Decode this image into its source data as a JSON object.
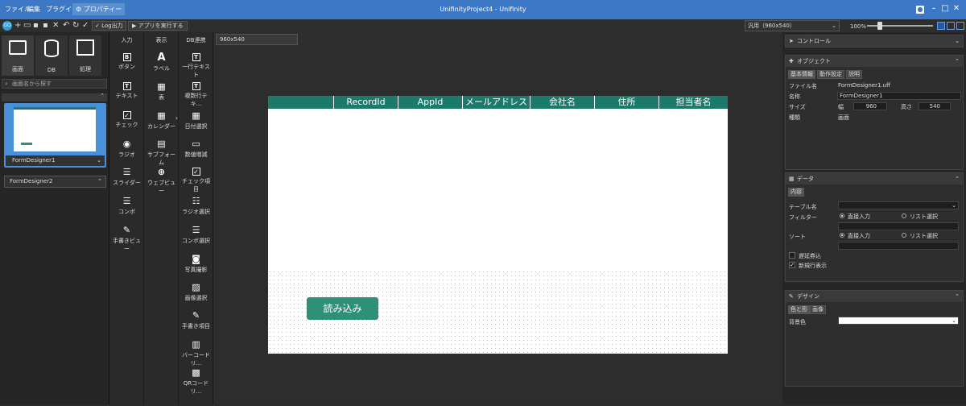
{
  "titlebar": {
    "menus": [
      "ファイル",
      "編集",
      "プラグイン",
      "⚙ プロパティー"
    ],
    "title": "UnifinityProject4 - Unifinity"
  },
  "toolbar": {
    "log_label": "Log出力",
    "run_label": "▶ アプリを実行する",
    "resolution": "汎用（960x540）",
    "zoom": "100%",
    "zoom_fraction": 0.2
  },
  "left": {
    "tabs": [
      "画面",
      "DB",
      "処理"
    ],
    "search_placeholder": "画面名から探す",
    "forms": [
      "FormDesigner1",
      "FormDesigner2"
    ]
  },
  "toolbox": {
    "input": {
      "header": "入力",
      "items": [
        "ボタン",
        "テキスト",
        "チェック",
        "ラジオ",
        "スライダー",
        "コンボ",
        "手書きビュー"
      ]
    },
    "display": {
      "header": "表示",
      "items": [
        "ラベル",
        "表",
        "カレンダー",
        "サブフォーム",
        "ウェブビュー"
      ]
    },
    "db": {
      "header": "DB連携",
      "items": [
        "一行テキスト",
        "複数行テキ...",
        "日付選択",
        "数値増減",
        "チェック項目",
        "ラジオ選択",
        "コンボ選択",
        "写真撮影",
        "画像選択",
        "手書き項目",
        "バーコードリ...",
        "QRコードリ..."
      ]
    }
  },
  "canvas": {
    "tab_label": "960x540",
    "grid_headers": [
      "RecordId",
      "AppId",
      "メールアドレス",
      "会社名",
      "住所",
      "担当者名"
    ],
    "load_button": "読み込み"
  },
  "right": {
    "control_label": "コントロール",
    "object": {
      "title": "オブジェクト",
      "tabs": [
        "基本情報",
        "動作設定",
        "説明"
      ],
      "filename_label": "ファイル名",
      "filename": "FormDesigner1.uff",
      "name_label": "名称",
      "name": "FormDesigner1",
      "size_label": "サイズ",
      "width_label": "幅",
      "width": "960",
      "height_label": "高さ",
      "height": "540",
      "kind_label": "種類",
      "kind": "画面"
    },
    "data": {
      "title": "データ",
      "tab": "内容",
      "table_label": "テーブル名",
      "filter_label": "フィルター",
      "sort_label": "ソート",
      "direct_input": "直接入力",
      "list_select": "リスト選択",
      "lazy_load": "遅延券込",
      "new_row": "新規行表示"
    },
    "design": {
      "title": "デザイン",
      "tabs": [
        "色と形",
        "画像"
      ],
      "bg_label": "背景色"
    }
  },
  "colors": {
    "titlebar": "#3c78c5",
    "grid_header": "#1b7a6a",
    "button": "#2e9177",
    "selected_form": "#4a90d8"
  }
}
